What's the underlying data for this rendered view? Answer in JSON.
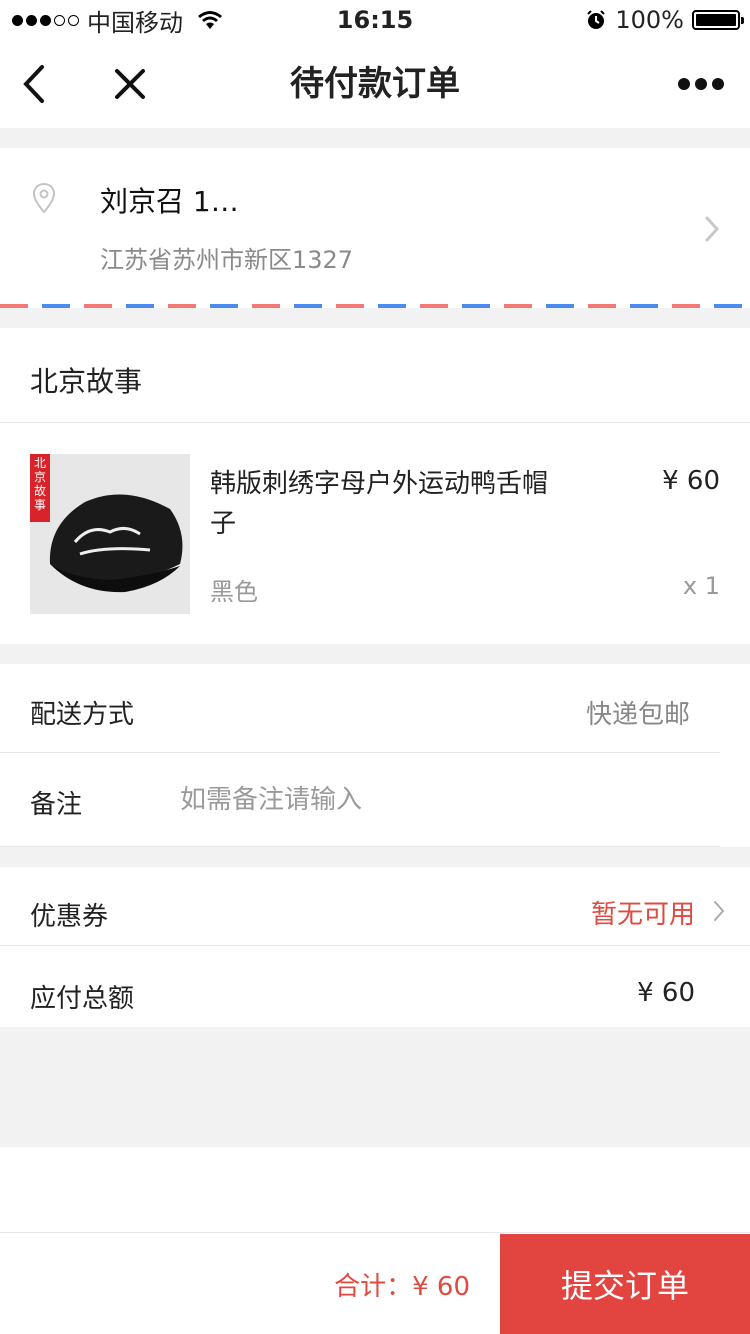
{
  "status_bar": {
    "carrier": "中国移动",
    "time": "16:15",
    "battery": "100%",
    "signal_bars_filled": 3,
    "signal_bars_total": 5
  },
  "nav": {
    "title": "待付款订单",
    "back_icon": "back-icon",
    "close_icon": "close-icon",
    "more_icon": "more-icon"
  },
  "address": {
    "name_phone": "刘京召 1…",
    "detail": "江苏省苏州市新区1327"
  },
  "store": {
    "name": "北京故事",
    "brand_tag": "北京故事"
  },
  "product": {
    "title": "韩版刺绣字母户外运动鸭舌帽子",
    "price": "¥ 60",
    "color": "黑色",
    "quantity": "x 1"
  },
  "delivery": {
    "label": "配送方式",
    "value": "快递包邮"
  },
  "notes": {
    "label": "备注",
    "placeholder": "如需备注请输入"
  },
  "coupon": {
    "label": "优惠券",
    "value": "暂无可用"
  },
  "total": {
    "label": "应付总额",
    "value": "¥ 60"
  },
  "bottom": {
    "sum_text": "合计：¥ 60",
    "submit_label": "提交订单"
  },
  "colors": {
    "accent": "#e24440",
    "highlight_text": "#e04a3f"
  }
}
